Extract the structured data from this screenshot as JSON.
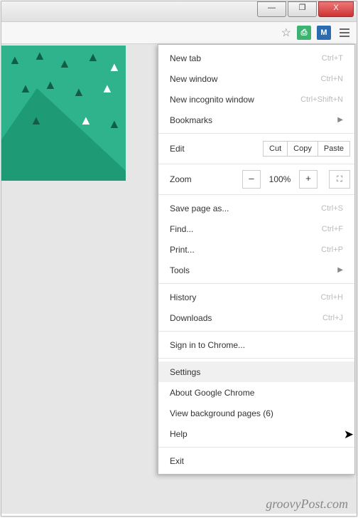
{
  "window": {
    "min": "—",
    "max": "❐",
    "close": "X"
  },
  "toolbar": {
    "star": "☆",
    "ext1": "⎙",
    "ext2": "M"
  },
  "menu": {
    "newtab": {
      "label": "New tab",
      "shortcut": "Ctrl+T"
    },
    "newwin": {
      "label": "New window",
      "shortcut": "Ctrl+N"
    },
    "incog": {
      "label": "New incognito window",
      "shortcut": "Ctrl+Shift+N"
    },
    "bookmarks": {
      "label": "Bookmarks",
      "arrow": "▶"
    },
    "edit": {
      "label": "Edit",
      "cut": "Cut",
      "copy": "Copy",
      "paste": "Paste"
    },
    "zoom": {
      "label": "Zoom",
      "minus": "–",
      "value": "100%",
      "plus": "+",
      "fs": "⛶"
    },
    "save": {
      "label": "Save page as...",
      "shortcut": "Ctrl+S"
    },
    "find": {
      "label": "Find...",
      "shortcut": "Ctrl+F"
    },
    "print": {
      "label": "Print...",
      "shortcut": "Ctrl+P"
    },
    "tools": {
      "label": "Tools",
      "arrow": "▶"
    },
    "history": {
      "label": "History",
      "shortcut": "Ctrl+H"
    },
    "downloads": {
      "label": "Downloads",
      "shortcut": "Ctrl+J"
    },
    "signin": {
      "label": "Sign in to Chrome..."
    },
    "settings": {
      "label": "Settings"
    },
    "about": {
      "label": "About Google Chrome"
    },
    "bgpages": {
      "label": "View background pages (6)"
    },
    "help": {
      "label": "Help"
    },
    "exit": {
      "label": "Exit"
    }
  },
  "watermark": "groovyPost.com"
}
